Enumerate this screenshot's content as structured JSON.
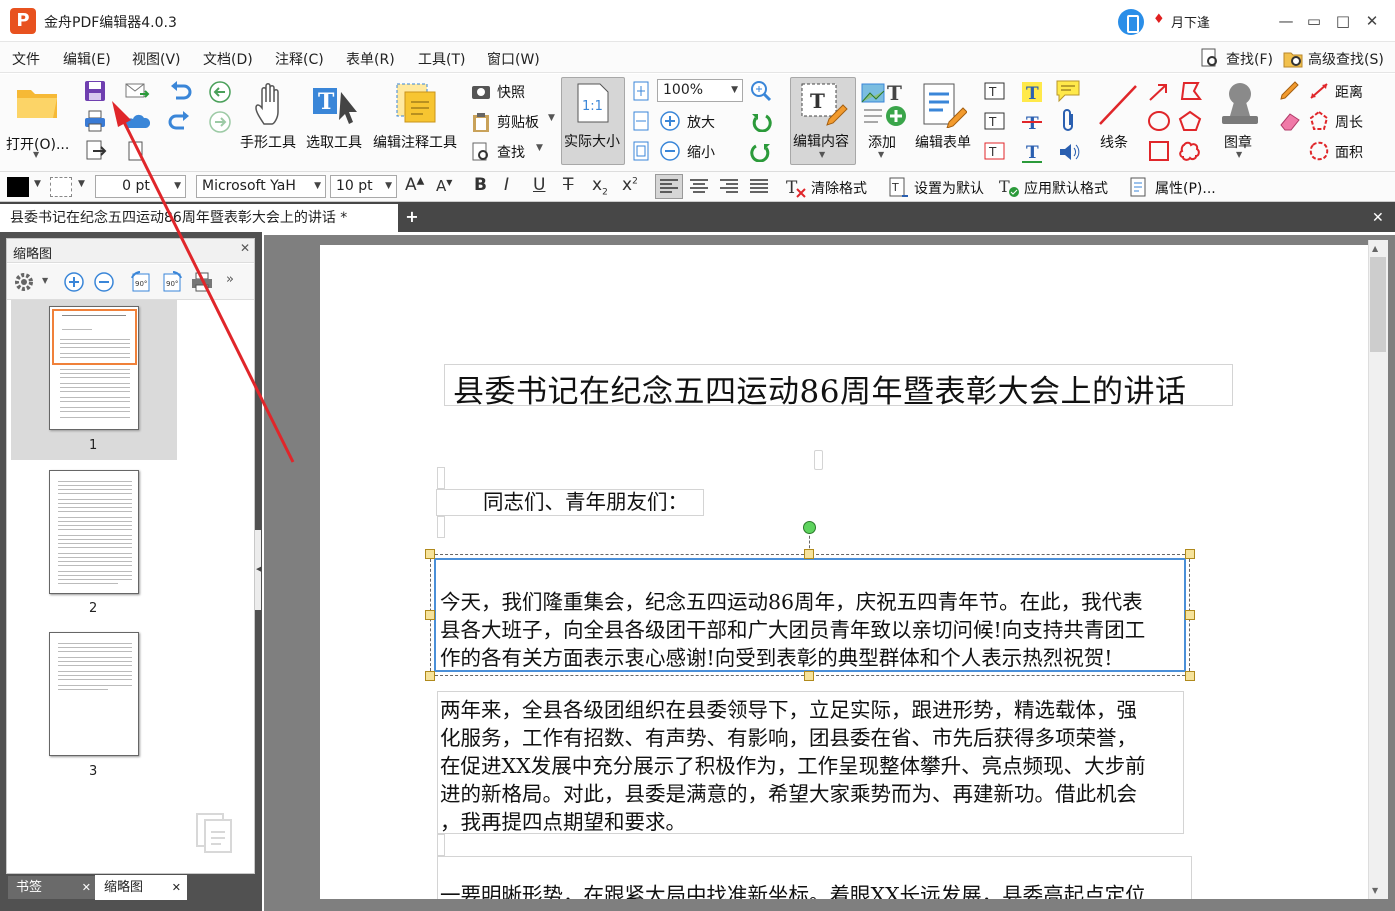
{
  "app": {
    "title": "金舟PDF编辑器4.0.3",
    "logo_letter": "P",
    "user": "月下逢",
    "window_buttons": [
      "—",
      "▭",
      "□",
      "✕"
    ]
  },
  "menu": [
    "文件",
    "编辑(E)",
    "视图(V)",
    "文档(D)",
    "注释(C)",
    "表单(R)",
    "工具(T)",
    "窗口(W)"
  ],
  "menu_right": {
    "find": "查找(F)",
    "advanced_find": "高级查找(S)"
  },
  "ribbon": {
    "open": "打开(O)...",
    "hand_tool": "手形工具",
    "select_tool": "选取工具",
    "edit_annot": "编辑注释工具",
    "snapshot": "快照",
    "clipboard": "剪贴板",
    "find": "查找",
    "actual_size": "实际大小",
    "zoom": "100%",
    "zoom_in": "放大",
    "zoom_out": "缩小",
    "edit_content": "编辑内容",
    "add": "添加",
    "edit_form": "编辑表单",
    "line": "线条",
    "stamp": "图章",
    "distance": "距离",
    "perimeter": "周长",
    "area": "面积"
  },
  "format": {
    "line_width": "0 pt",
    "font": "Microsoft YaH",
    "size": "10 pt",
    "clear_format": "清除格式",
    "set_default": "设置为默认",
    "apply_default": "应用默认格式",
    "properties": "属性(P)..."
  },
  "tab": {
    "title": "县委书记在纪念五四运动86周年暨表彰大会上的讲话 *"
  },
  "thumbs": {
    "title": "缩略图",
    "pages": [
      "1",
      "2",
      "3"
    ],
    "bookmark_tab": "书签",
    "thumbnail_tab": "缩略图"
  },
  "document": {
    "title": "县委书记在纪念五四运动86周年暨表彰大会上的讲话",
    "greeting": "同志们、青年朋友们：",
    "para1": [
      "今天，我们隆重集会，纪念五四运动86周年，庆祝五四青年节。在此，我代表",
      "县各大班子，向全县各级团干部和广大团员青年致以亲切问候!向支持共青团工",
      "作的各有关方面表示衷心感谢!向受到表彰的典型群体和个人表示热烈祝贺!"
    ],
    "para2": [
      "两年来，全县各级团组织在县委领导下，立足实际，跟进形势，精选载体，强",
      "化服务，工作有招数、有声势、有影响，团县委在省、市先后获得多项荣誉，",
      "在促进XX发展中充分展示了积极作为，工作呈现整体攀升、亮点频现、大步前",
      "进的新格局。对此，县委是满意的，希望大家乘势而为、再建新功。借此机会",
      "，我再提四点期望和要求。"
    ],
    "para3": "一要明晰形势，在跟紧大局中找准新坐标。着眼XX长远发展，县委高起点定位"
  },
  "colors": {
    "accent": "#e8521f",
    "arrow": "#e0262a",
    "selection": "#4a8fd8",
    "handle": "#f6e39b"
  }
}
